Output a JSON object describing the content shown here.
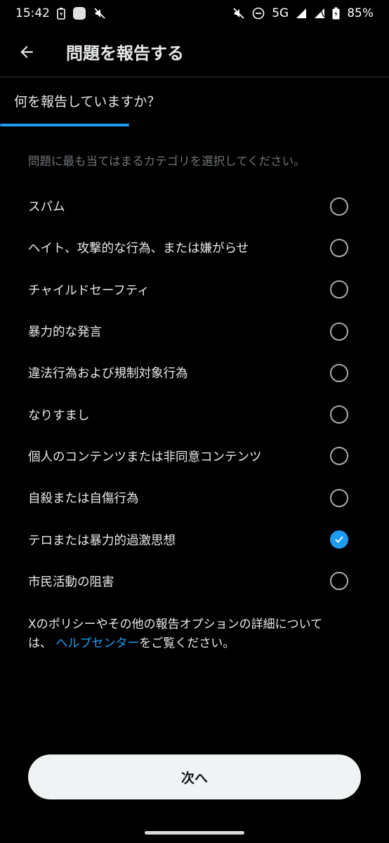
{
  "status_bar": {
    "time": "15:42",
    "network": "5G",
    "battery": "85%",
    "icons_left": [
      "battery-charging-icon",
      "app-notification-icon",
      "mute-icon"
    ],
    "icons_right": [
      "vibrate-off-icon",
      "do-not-disturb-icon",
      "signal-icon",
      "signal-icon",
      "battery-icon"
    ]
  },
  "header": {
    "title": "問題を報告する",
    "back_icon": "arrow-left-icon"
  },
  "question": "何を報告していますか？",
  "instruction": "問題に最も当てはまるカテゴリを選択してください。",
  "options": [
    {
      "label": "スパム",
      "checked": false
    },
    {
      "label": "ヘイト、攻撃的な行為、または嫌がらせ",
      "checked": false
    },
    {
      "label": "チャイルドセーフティ",
      "checked": false
    },
    {
      "label": "暴力的な発言",
      "checked": false
    },
    {
      "label": "違法行為および規制対象行為",
      "checked": false
    },
    {
      "label": "なりすまし",
      "checked": false
    },
    {
      "label": "個人のコンテンツまたは非同意コンテンツ",
      "checked": false
    },
    {
      "label": "自殺または自傷行為",
      "checked": false
    },
    {
      "label": "テロまたは暴力的過激思想",
      "checked": true
    },
    {
      "label": "市民活動の阻害",
      "checked": false
    }
  ],
  "note": {
    "line1": "Xのポリシーやその他の報告オプションの詳細について",
    "prefix": "は、",
    "link": "ヘルプセンター",
    "suffix": "をご覧ください。"
  },
  "next_button": "次へ",
  "colors": {
    "accent": "#1d9bf0",
    "background": "#000000",
    "text": "#e7e9ea",
    "muted": "#71767b"
  }
}
